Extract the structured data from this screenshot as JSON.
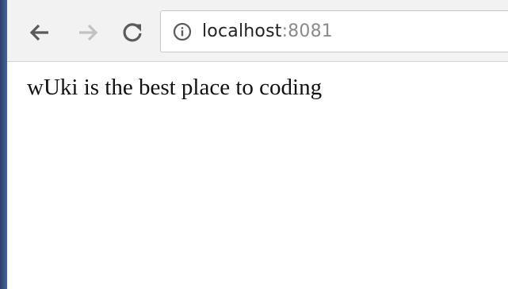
{
  "browser": {
    "url": {
      "host": "localhost",
      "port": ":8081"
    },
    "icons": {
      "back": "back-arrow-icon",
      "forward": "forward-arrow-icon",
      "reload": "reload-icon",
      "info": "info-icon"
    },
    "colors": {
      "toolbar_bg": "#f2f2f2",
      "icon_active": "#5a5a5a",
      "icon_disabled": "#c2c2c2",
      "url_port": "#8a8a8a"
    }
  },
  "page": {
    "text": "wUki is the best place to coding"
  }
}
